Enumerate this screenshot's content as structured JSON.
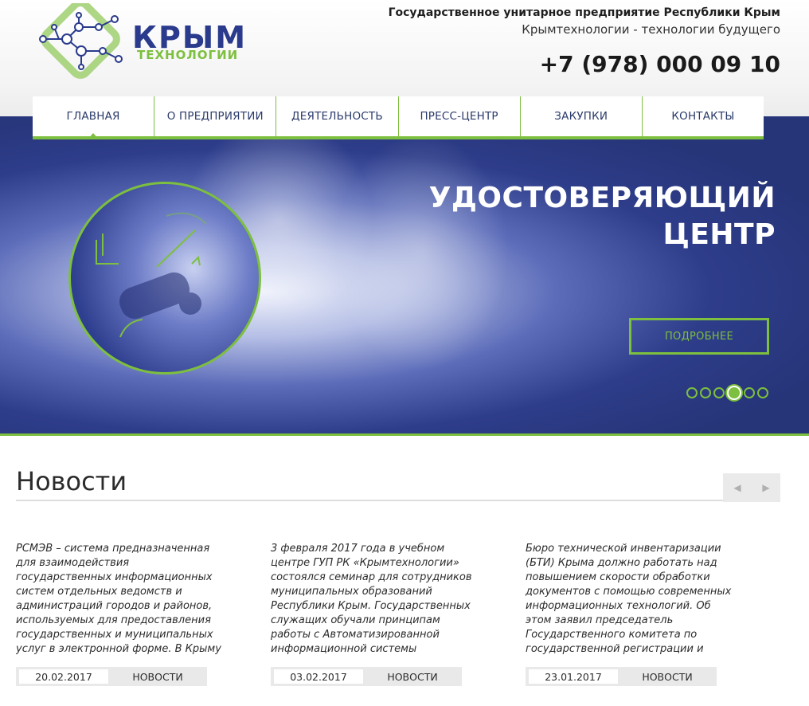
{
  "header": {
    "logo_text": "КРЫМ",
    "logo_subtext": "ТЕХНОЛОГИИ",
    "org_name": "Государственное унитарное предприятие Республики Крым",
    "tagline": "Крымтехнологии - технологии будущего",
    "phone": "+7 (978) 000 09 10"
  },
  "nav": {
    "items": [
      {
        "label": "ГЛАВНАЯ"
      },
      {
        "label": "О ПРЕДПРИЯТИИ"
      },
      {
        "label": "ДЕЯТЕЛЬНОСТЬ"
      },
      {
        "label": "ПРЕСС-ЦЕНТР"
      },
      {
        "label": "ЗАКУПКИ"
      },
      {
        "label": "КОНТАКТЫ"
      }
    ]
  },
  "hero": {
    "title_line1": "УДОСТОВЕРЯЮЩИЙ",
    "title_line2": "ЦЕНТР",
    "button_label": "ПОДРОБНЕЕ",
    "slide_count": 6,
    "active_slide": 4
  },
  "news": {
    "title": "Новости",
    "prev_icon": "chevron-left-icon",
    "next_icon": "chevron-right-icon",
    "cards": [
      {
        "text": "РСМЭВ – система предназначенная для взаимодействия государственных информационных систем отдельных ведомств и администраций городов и районов, используемых для предоставления государственных и муниципальных услуг в электронной форме. В Крыму",
        "date": "20.02.2017",
        "category": "НОВОСТИ"
      },
      {
        "text": "3 февраля 2017 года в учебном центре ГУП РК «Крымтехнологии» состоялся семинар для сотрудников муниципальных образований Республики Крым. Государственных служащих обучали принципам работы с Автоматизированной информационной системы",
        "date": "03.02.2017",
        "category": "НОВОСТИ"
      },
      {
        "text": "Бюро технической инвентаризации (БТИ) Крыма должно работать над повышением скорости обработки документов с помощью современных информационных технологий. Об этом заявил председатель Государственного комитета по государственной регистрации и",
        "date": "23.01.2017",
        "category": "НОВОСТИ"
      }
    ]
  },
  "colors": {
    "accent_green": "#7dbf3f",
    "brand_blue": "#2a3a8c",
    "hero_blue": "#263478"
  }
}
